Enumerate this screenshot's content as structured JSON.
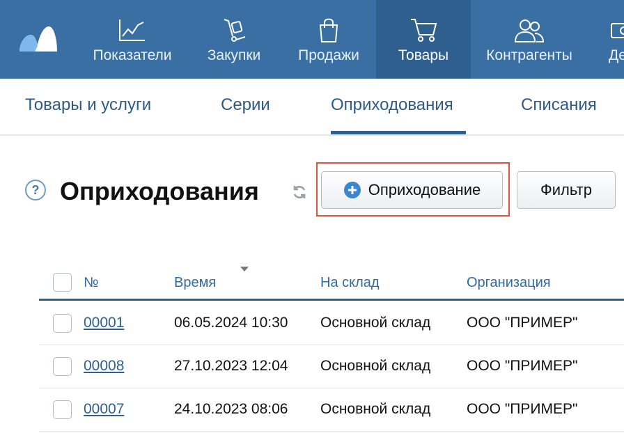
{
  "topnav": {
    "items": [
      {
        "label": "Показатели",
        "icon": "chart-icon"
      },
      {
        "label": "Закупки",
        "icon": "hand-truck-icon"
      },
      {
        "label": "Продажи",
        "icon": "shopping-bag-icon"
      },
      {
        "label": "Товары",
        "icon": "cart-icon",
        "active": true
      },
      {
        "label": "Контрагенты",
        "icon": "users-icon"
      },
      {
        "label": "Де",
        "icon": "money-icon"
      }
    ]
  },
  "subnav": {
    "tabs": [
      {
        "label": "Товары и услуги"
      },
      {
        "label": "Серии"
      },
      {
        "label": "Оприходования",
        "active": true
      },
      {
        "label": "Списания"
      }
    ]
  },
  "page": {
    "help": "?",
    "title": "Оприходования",
    "add_button": "Оприходование",
    "filter_button": "Фильтр"
  },
  "table": {
    "headers": {
      "number": "№",
      "time": "Время",
      "warehouse": "На склад",
      "organization": "Организация"
    },
    "rows": [
      {
        "number": "00001",
        "time": "06.05.2024 10:30",
        "warehouse": "Основной склад",
        "organization": "ООО \"ПРИМЕР\""
      },
      {
        "number": "00008",
        "time": "27.10.2023 12:04",
        "warehouse": "Основной склад",
        "organization": "ООО \"ПРИМЕР\""
      },
      {
        "number": "00007",
        "time": "24.10.2023 08:06",
        "warehouse": "Основной склад",
        "organization": "ООО \"ПРИМЕР\""
      }
    ]
  },
  "colors": {
    "nav_bg": "#3a6fa3",
    "nav_active_bg": "#2f5f8e",
    "link": "#2f5f8e",
    "highlight": "#e0533b",
    "add_icon": "#3a86d0"
  }
}
